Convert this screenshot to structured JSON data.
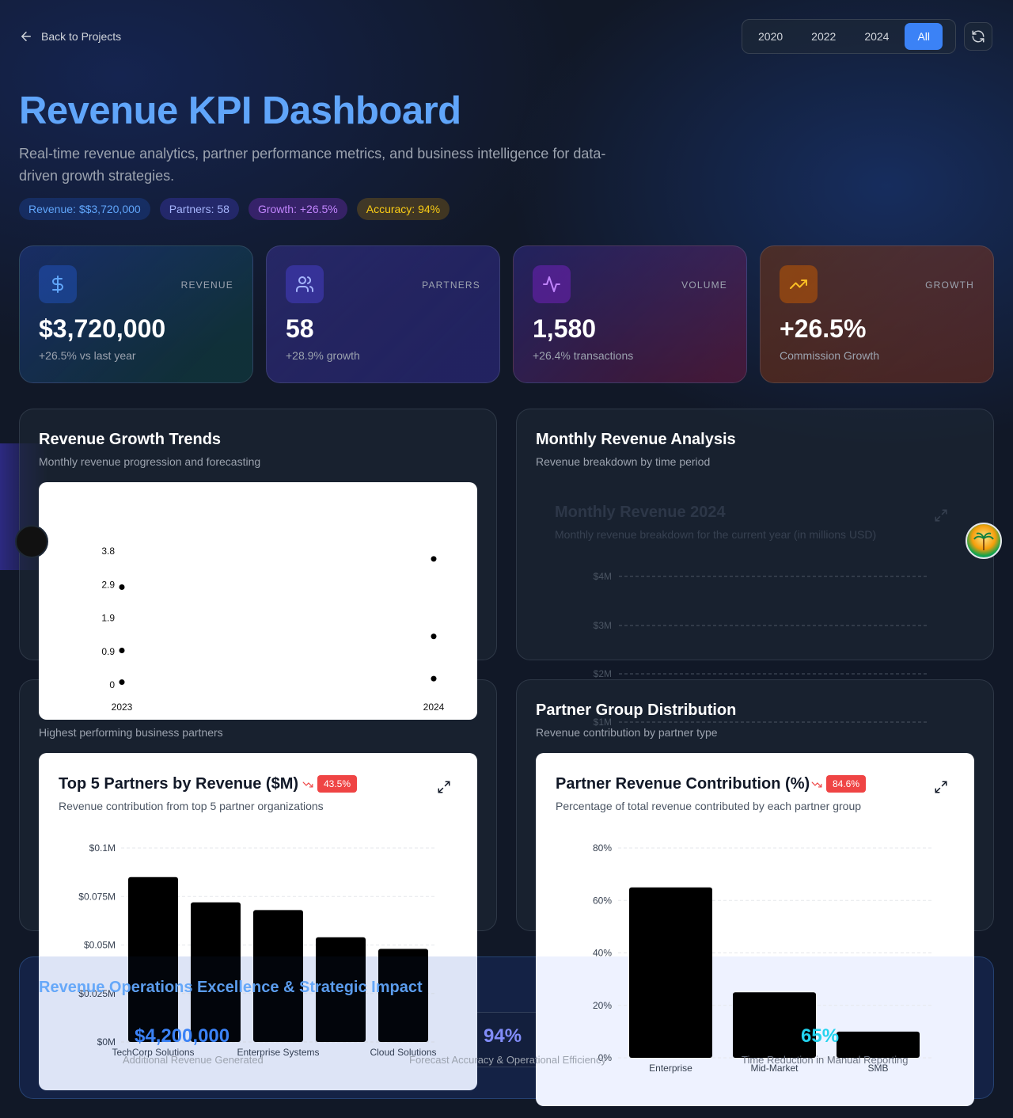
{
  "nav": {
    "back_label": "Back to Projects"
  },
  "filters": {
    "options": [
      "2020",
      "2022",
      "2024",
      "All"
    ],
    "active": "All"
  },
  "header": {
    "title": "Revenue KPI Dashboard",
    "subtitle": "Real-time revenue analytics, partner performance metrics, and business intelligence for data-driven growth strategies."
  },
  "pills": {
    "revenue": "Revenue: $$3,720,000",
    "partners": "Partners: 58",
    "growth": "Growth: +26.5%",
    "accuracy": "Accuracy: 94%"
  },
  "kpis": [
    {
      "label": "REVENUE",
      "value": "$3,720,000",
      "sub": "+26.5% vs last year",
      "icon": "dollar-icon"
    },
    {
      "label": "PARTNERS",
      "value": "58",
      "sub": "+28.9% growth",
      "icon": "users-icon"
    },
    {
      "label": "VOLUME",
      "value": "1,580",
      "sub": "+26.4% transactions",
      "icon": "activity-icon"
    },
    {
      "label": "GROWTH",
      "value": "+26.5%",
      "sub": "Commission Growth",
      "icon": "trending-up-icon"
    }
  ],
  "panels": {
    "growth_trends": {
      "title": "Revenue Growth Trends",
      "subtitle": "Monthly revenue progression and forecasting"
    },
    "monthly": {
      "title": "Monthly Revenue Analysis",
      "subtitle": "Revenue breakdown by time period"
    },
    "monthly_chart": {
      "title": "Monthly Revenue 2024",
      "subtitle": "Monthly revenue breakdown for the current year (in millions USD)"
    },
    "top_partners": {
      "subtitle": "Highest performing business partners"
    },
    "partner_groups": {
      "title": "Partner Group Distribution",
      "subtitle": "Revenue contribution by partner type"
    }
  },
  "cards": {
    "top5": {
      "title": "Top 5 Partners by Revenue ($M)",
      "subtitle": "Revenue contribution from top 5 partner organizations",
      "badge": "43.5%"
    },
    "contribution": {
      "title": "Partner Revenue Contribution (%)",
      "subtitle": "Percentage of total revenue contributed by each partner group",
      "badge": "84.6%"
    }
  },
  "excellence": {
    "title": "Revenue Operations Excellence & Strategic Impact",
    "stats": [
      {
        "value": "$4,200,000",
        "label": "Additional Revenue Generated"
      },
      {
        "value": "94%",
        "label": "Forecast Accuracy & Operational Efficiency"
      },
      {
        "value": "65%",
        "label": "Time Reduction in Manual Reporting"
      }
    ]
  },
  "colors": {
    "accent": "#3b82f6",
    "title_blue": "#60a5fa",
    "badge_red": "#ef4444",
    "background": "#111827"
  },
  "chart_data": [
    {
      "type": "scatter",
      "title": "",
      "x_ticks": [
        "2023",
        "2024"
      ],
      "y_ticks": [
        "0",
        "0.9",
        "1.9",
        "2.9",
        "3.8"
      ],
      "ylim": [
        0,
        3.8
      ],
      "points": [
        {
          "x": "2023",
          "y": 0.1
        },
        {
          "x": "2023",
          "y": 1.0
        },
        {
          "x": "2023",
          "y": 2.8
        },
        {
          "x": "2024",
          "y": 0.2
        },
        {
          "x": "2024",
          "y": 1.4
        },
        {
          "x": "2024",
          "y": 3.6
        }
      ]
    },
    {
      "type": "bar",
      "title": "Monthly Revenue 2024",
      "y_ticks": [
        "$4M",
        "$3M",
        "$2M",
        "$1M"
      ],
      "grid": true
    },
    {
      "type": "bar",
      "title": "Top 5 Partners by Revenue ($M)",
      "categories": [
        "TechCorp Solutions",
        "",
        "Enterprise Systems",
        "",
        "Cloud Solutions"
      ],
      "values": [
        0.085,
        0.072,
        0.068,
        0.054,
        0.048
      ],
      "y_ticks": [
        "$0M",
        "$0.025M",
        "$0.05M",
        "$0.075M",
        "$0.1M"
      ],
      "ylim": [
        0,
        0.1
      ],
      "grid": true
    },
    {
      "type": "bar",
      "title": "Partner Revenue Contribution (%)",
      "categories": [
        "Enterprise",
        "Mid-Market",
        "SMB"
      ],
      "values": [
        65,
        25,
        10
      ],
      "y_ticks": [
        "0%",
        "20%",
        "40%",
        "60%",
        "80%"
      ],
      "ylim": [
        0,
        80
      ],
      "grid": true
    }
  ]
}
